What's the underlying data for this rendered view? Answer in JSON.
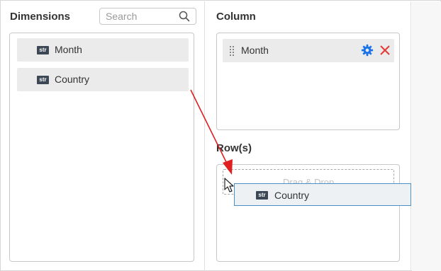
{
  "dimensions": {
    "heading": "Dimensions",
    "search": {
      "placeholder": "Search",
      "value": ""
    },
    "items": [
      {
        "badge": "str",
        "label": "Month"
      },
      {
        "badge": "str",
        "label": "Country"
      }
    ]
  },
  "column": {
    "heading": "Column",
    "items": [
      {
        "label": "Month"
      }
    ]
  },
  "rows": {
    "heading": "Row(s)",
    "dropzone_text": "Drag & Drop"
  },
  "drag_ghost": {
    "badge": "str",
    "label": "Country"
  },
  "colors": {
    "accent_blue": "#1a73e8",
    "remove_red": "#e53935",
    "arrow_red": "#e02020",
    "badge_bg": "#3c4856",
    "field_bg": "#ebebeb"
  },
  "icons": [
    "search-icon",
    "drag-handle-icon",
    "gear-icon",
    "close-icon",
    "cursor-icon"
  ]
}
